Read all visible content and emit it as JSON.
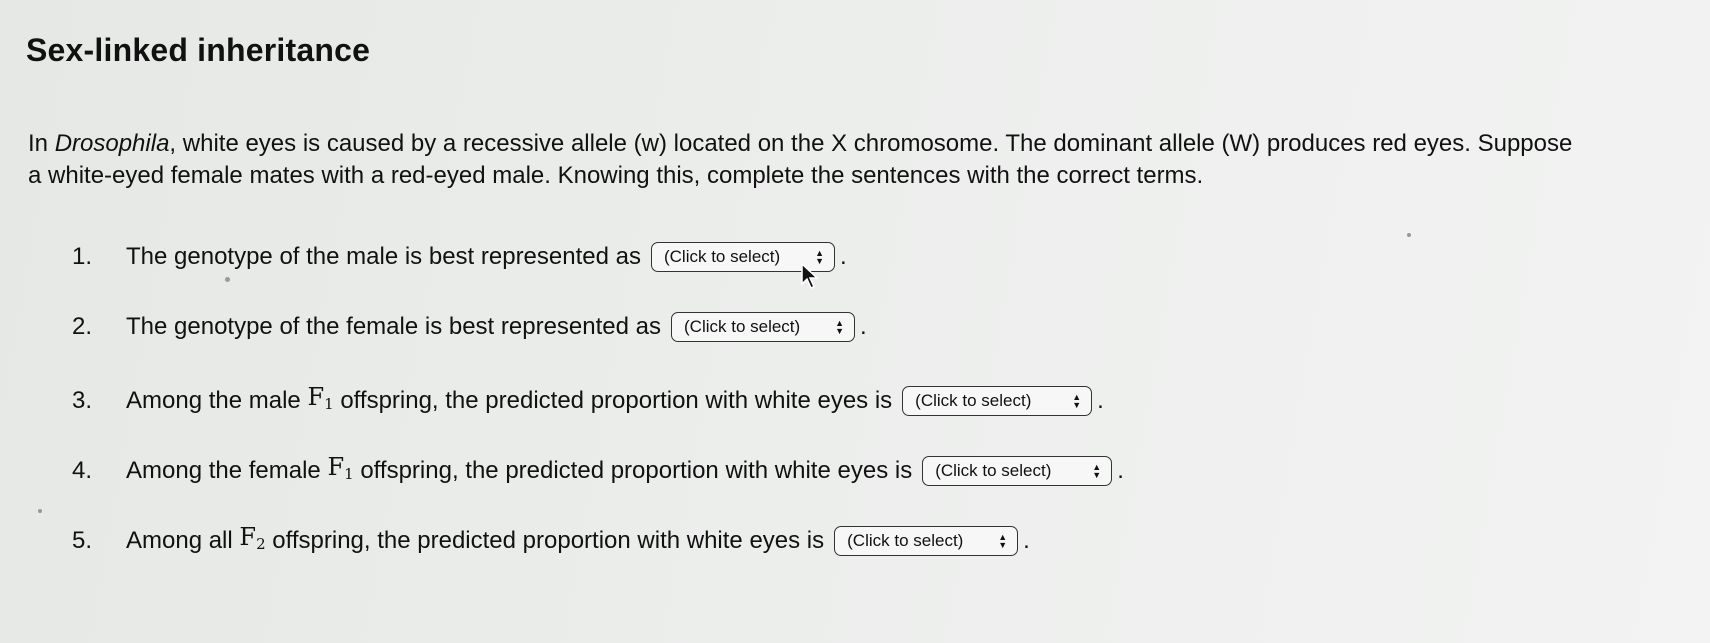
{
  "title": "Sex-linked inheritance",
  "intro": {
    "pre": "In ",
    "italic": "Drosophila",
    "post": ", white eyes is caused by a recessive allele (w) located on the X chromosome. The dominant allele (W) produces red eyes. Suppose a white-eyed female mates with a red-eyed male. Knowing this, complete the sentences with the correct terms."
  },
  "questions": [
    {
      "num": "1.",
      "text": "The genotype of the male is best represented as",
      "select": "(Click to select)",
      "end": "."
    },
    {
      "num": "2.",
      "text": "The genotype of the female is best represented as",
      "select": "(Click to select)",
      "end": "."
    },
    {
      "num": "3.",
      "pre": "Among the male",
      "gen": "F",
      "gen_sub": "1",
      "post": "offspring, the predicted proportion with white eyes is",
      "select": "(Click to select)",
      "end": "."
    },
    {
      "num": "4.",
      "pre": "Among the female",
      "gen": "F",
      "gen_sub": "1",
      "post": "offspring, the predicted proportion with white eyes is",
      "select": "(Click to select)",
      "end": "."
    },
    {
      "num": "5.",
      "pre": "Among all",
      "gen": "F",
      "gen_sub": "2",
      "post": "offspring, the predicted proportion with white eyes is",
      "select": "(Click to select)",
      "end": "."
    }
  ],
  "stepper_up": "▲",
  "stepper_down": "▼"
}
